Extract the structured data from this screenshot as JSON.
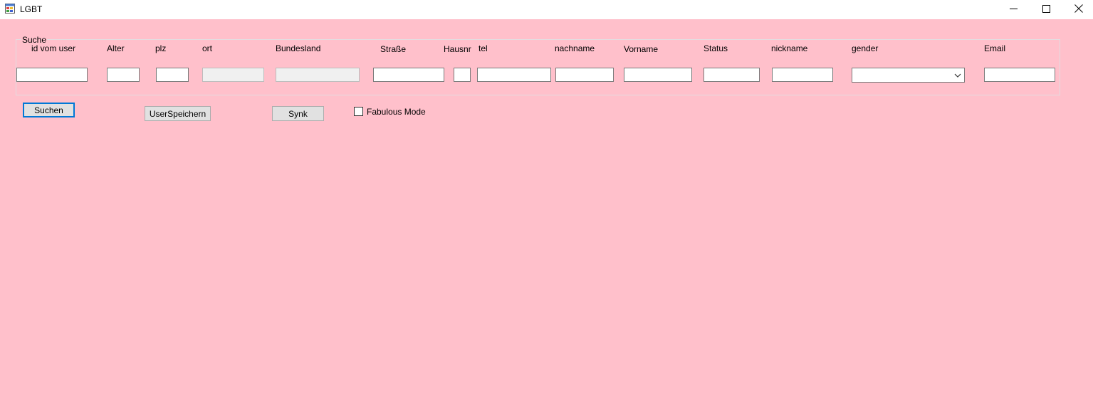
{
  "window": {
    "title": "LGBT",
    "background_color": "#ffc0cb"
  },
  "group": {
    "label": "Suche"
  },
  "fields": {
    "id_vom_user": {
      "label": "id vom user",
      "value": ""
    },
    "alter": {
      "label": "Alter",
      "value": ""
    },
    "plz": {
      "label": "plz",
      "value": ""
    },
    "ort": {
      "label": "ort",
      "value": ""
    },
    "bundesland": {
      "label": "Bundesland",
      "value": ""
    },
    "strasse": {
      "label": "Straße",
      "value": ""
    },
    "hausnr": {
      "label": "Hausnr",
      "value": ""
    },
    "tel": {
      "label": "tel",
      "value": ""
    },
    "nachname": {
      "label": "nachname",
      "value": ""
    },
    "vorname": {
      "label": "Vorname",
      "value": ""
    },
    "status": {
      "label": "Status",
      "value": ""
    },
    "nickname": {
      "label": "nickname",
      "value": ""
    },
    "gender": {
      "label": "gender",
      "selected": ""
    },
    "email": {
      "label": "Email",
      "value": ""
    }
  },
  "buttons": {
    "suchen": "Suchen",
    "user_speichern": "UserSpeichern",
    "synk": "Synk"
  },
  "checkbox": {
    "label": "Fabulous Mode",
    "checked": false
  },
  "icons": {
    "app": "app-window-icon",
    "minimize": "minimize-icon",
    "maximize": "maximize-icon",
    "close": "close-icon",
    "dropdown": "chevron-down-icon"
  }
}
